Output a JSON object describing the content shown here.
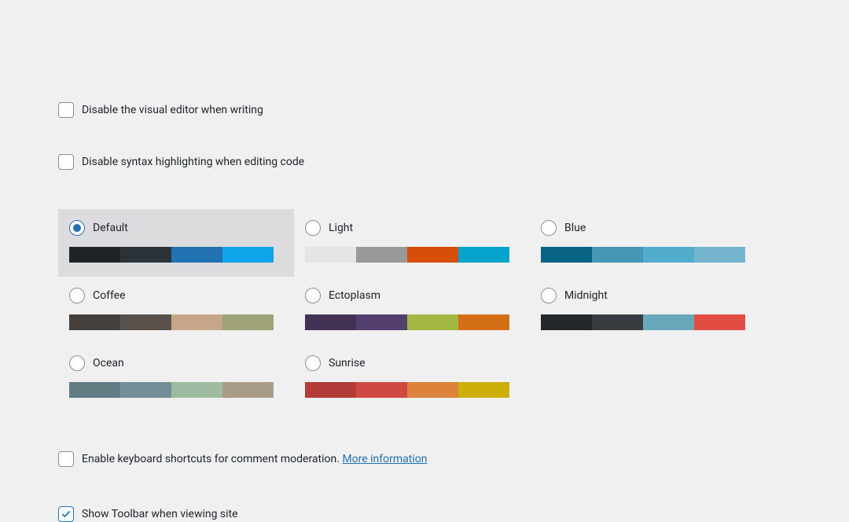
{
  "options": {
    "disable_visual_editor": {
      "label": "Disable the visual editor when writing",
      "checked": false
    },
    "disable_syntax_highlighting": {
      "label": "Disable syntax highlighting when editing code",
      "checked": false
    },
    "keyboard_shortcuts": {
      "label": "Enable keyboard shortcuts for comment moderation.",
      "link_text": "More information",
      "checked": false
    },
    "show_toolbar": {
      "label": "Show Toolbar when viewing site",
      "checked": true
    }
  },
  "schemes": [
    {
      "id": "default",
      "label": "Default",
      "selected": true,
      "colors": [
        "#1d2327",
        "#2c3338",
        "#2271b1",
        "#0ea5e9"
      ]
    },
    {
      "id": "light",
      "label": "Light",
      "selected": false,
      "colors": [
        "#e5e5e5",
        "#999999",
        "#d64e07",
        "#04a4cc"
      ]
    },
    {
      "id": "blue",
      "label": "Blue",
      "selected": false,
      "colors": [
        "#096484",
        "#4796b3",
        "#52accc",
        "#74b6ce"
      ]
    },
    {
      "id": "coffee",
      "label": "Coffee",
      "selected": false,
      "colors": [
        "#46403c",
        "#59524c",
        "#c7a589",
        "#9ea476"
      ]
    },
    {
      "id": "ectoplasm",
      "label": "Ectoplasm",
      "selected": false,
      "colors": [
        "#413256",
        "#523f6d",
        "#a3b745",
        "#d46f15"
      ]
    },
    {
      "id": "midnight",
      "label": "Midnight",
      "selected": false,
      "colors": [
        "#25282b",
        "#363b3f",
        "#69a8bb",
        "#e14d43"
      ]
    },
    {
      "id": "ocean",
      "label": "Ocean",
      "selected": false,
      "colors": [
        "#627c83",
        "#738e96",
        "#9ebaa0",
        "#aa9d88"
      ]
    },
    {
      "id": "sunrise",
      "label": "Sunrise",
      "selected": false,
      "colors": [
        "#b43c38",
        "#cf4944",
        "#dd823b",
        "#ccaf0b"
      ]
    }
  ]
}
